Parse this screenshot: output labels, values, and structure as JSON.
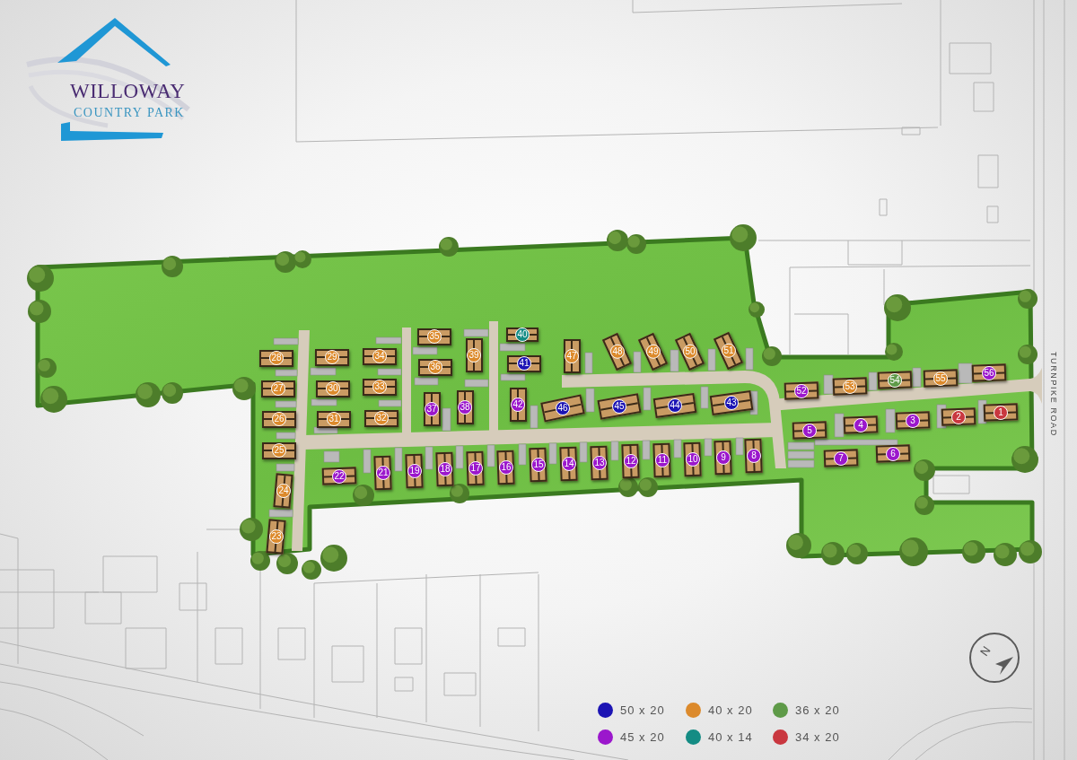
{
  "logo": {
    "name": "WILLOWAY",
    "tagline": "COUNTRY PARK"
  },
  "road_label": "TURNPIKE ROAD",
  "plots": [
    {
      "number": "35",
      "color": "#dc8a2c"
    },
    {
      "number": "40",
      "color": "#148c84"
    },
    {
      "number": "28",
      "color": "#dc8a2c"
    },
    {
      "number": "29",
      "color": "#dc8a2c"
    },
    {
      "number": "34",
      "color": "#dc8a2c"
    },
    {
      "number": "36",
      "color": "#dc8a2c"
    },
    {
      "number": "39",
      "color": "#dc8a2c"
    },
    {
      "number": "41",
      "color": "#1c14b4"
    },
    {
      "number": "47",
      "color": "#dc8a2c"
    },
    {
      "number": "48",
      "color": "#dc8a2c"
    },
    {
      "number": "49",
      "color": "#dc8a2c"
    },
    {
      "number": "50",
      "color": "#dc8a2c"
    },
    {
      "number": "51",
      "color": "#dc8a2c"
    },
    {
      "number": "27",
      "color": "#dc8a2c"
    },
    {
      "number": "30",
      "color": "#dc8a2c"
    },
    {
      "number": "33",
      "color": "#dc8a2c"
    },
    {
      "number": "52",
      "color": "#9b17cc"
    },
    {
      "number": "53",
      "color": "#dc8a2c"
    },
    {
      "number": "54",
      "color": "#5e9a48"
    },
    {
      "number": "55",
      "color": "#dc8a2c"
    },
    {
      "number": "56",
      "color": "#9b17cc"
    },
    {
      "number": "26",
      "color": "#dc8a2c"
    },
    {
      "number": "31",
      "color": "#dc8a2c"
    },
    {
      "number": "32",
      "color": "#dc8a2c"
    },
    {
      "number": "37",
      "color": "#9b17cc"
    },
    {
      "number": "38",
      "color": "#9b17cc"
    },
    {
      "number": "42",
      "color": "#9b17cc"
    },
    {
      "number": "46",
      "color": "#1c14b4"
    },
    {
      "number": "45",
      "color": "#1c14b4"
    },
    {
      "number": "44",
      "color": "#1c14b4"
    },
    {
      "number": "43",
      "color": "#1c14b4"
    },
    {
      "number": "5",
      "color": "#9b17cc"
    },
    {
      "number": "4",
      "color": "#9b17cc"
    },
    {
      "number": "3",
      "color": "#9b17cc"
    },
    {
      "number": "2",
      "color": "#c9373f"
    },
    {
      "number": "1",
      "color": "#c9373f"
    },
    {
      "number": "25",
      "color": "#dc8a2c"
    },
    {
      "number": "22",
      "color": "#9b17cc"
    },
    {
      "number": "21",
      "color": "#9b17cc"
    },
    {
      "number": "19",
      "color": "#9b17cc"
    },
    {
      "number": "18",
      "color": "#9b17cc"
    },
    {
      "number": "17",
      "color": "#9b17cc"
    },
    {
      "number": "16",
      "color": "#9b17cc"
    },
    {
      "number": "15",
      "color": "#9b17cc"
    },
    {
      "number": "14",
      "color": "#9b17cc"
    },
    {
      "number": "13",
      "color": "#9b17cc"
    },
    {
      "number": "12",
      "color": "#9b17cc"
    },
    {
      "number": "11",
      "color": "#9b17cc"
    },
    {
      "number": "10",
      "color": "#9b17cc"
    },
    {
      "number": "9",
      "color": "#9b17cc"
    },
    {
      "number": "8",
      "color": "#9b17cc"
    },
    {
      "number": "7",
      "color": "#9b17cc"
    },
    {
      "number": "6",
      "color": "#9b17cc"
    },
    {
      "number": "24",
      "color": "#dc8a2c"
    },
    {
      "number": "23",
      "color": "#dc8a2c"
    }
  ],
  "compass": {
    "label": "N"
  },
  "legend": [
    {
      "label": "50 x 20",
      "color": "#1c14b4"
    },
    {
      "label": "40 x 20",
      "color": "#dc8a2c"
    },
    {
      "label": "36 x 20",
      "color": "#5e9a48"
    },
    {
      "label": "45 x 20",
      "color": "#9b17cc"
    },
    {
      "label": "40 x 14",
      "color": "#148c84"
    },
    {
      "label": "34 x 20",
      "color": "#c9373f"
    }
  ]
}
